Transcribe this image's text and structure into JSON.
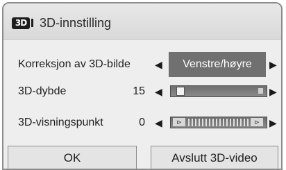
{
  "dialog": {
    "badge": "3D",
    "title": "3D-innstilling"
  },
  "rows": {
    "correction": {
      "label": "Korreksjon av 3D-bilde",
      "value": "Venstre/høyre"
    },
    "depth": {
      "label": "3D-dybde",
      "value": "15",
      "level_fraction": 0.05
    },
    "viewpoint": {
      "label": "3D-visningspunkt",
      "value": "0"
    }
  },
  "buttons": {
    "ok": "OK",
    "exit": "Avslutt 3D-video"
  },
  "colors": {
    "highlight": "#707070",
    "background": "#eeeeee"
  },
  "icons": [
    "3d-badge-icon",
    "arrow-left-icon",
    "arrow-right-icon"
  ]
}
